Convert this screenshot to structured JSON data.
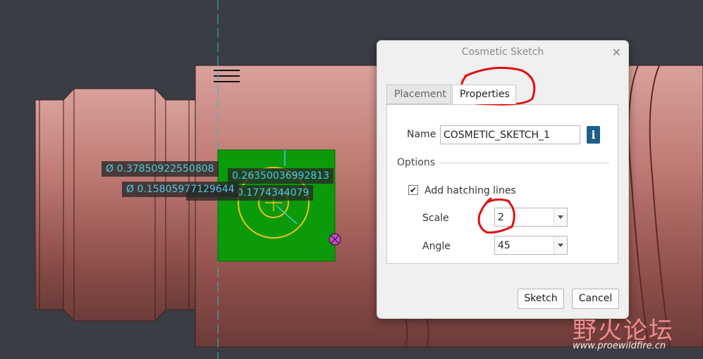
{
  "viewport": {
    "dimensions": [
      "0.37850922550808",
      "0.15805977129644",
      "0.26350036992813",
      "0.1774344079"
    ],
    "diameter_symbol": "Ø"
  },
  "dialog": {
    "title": "Cosmetic Sketch",
    "close_glyph": "✕",
    "tabs": [
      {
        "label": "Placement",
        "active": false
      },
      {
        "label": "Properties",
        "active": true
      }
    ],
    "name_label": "Name",
    "name_value": "COSMETIC_SKETCH_1",
    "info_glyph": "i",
    "options_label": "Options",
    "hatch_label": "Add hatching lines",
    "hatch_checked": "✔",
    "scale_label": "Scale",
    "scale_value": "2",
    "angle_label": "Angle",
    "angle_value": "45",
    "sketch_button": "Sketch",
    "cancel_button": "Cancel"
  },
  "watermark": {
    "text": "野火论坛",
    "url": "www.proewildfire.cn"
  },
  "colors": {
    "background": "#3a3d44",
    "part": "#b9736e",
    "sketch_fill": "#0a9a0a",
    "sketch_lines": "#f0c020",
    "dimension_text": "#4fc8e0",
    "annotation_red": "#e01010"
  }
}
